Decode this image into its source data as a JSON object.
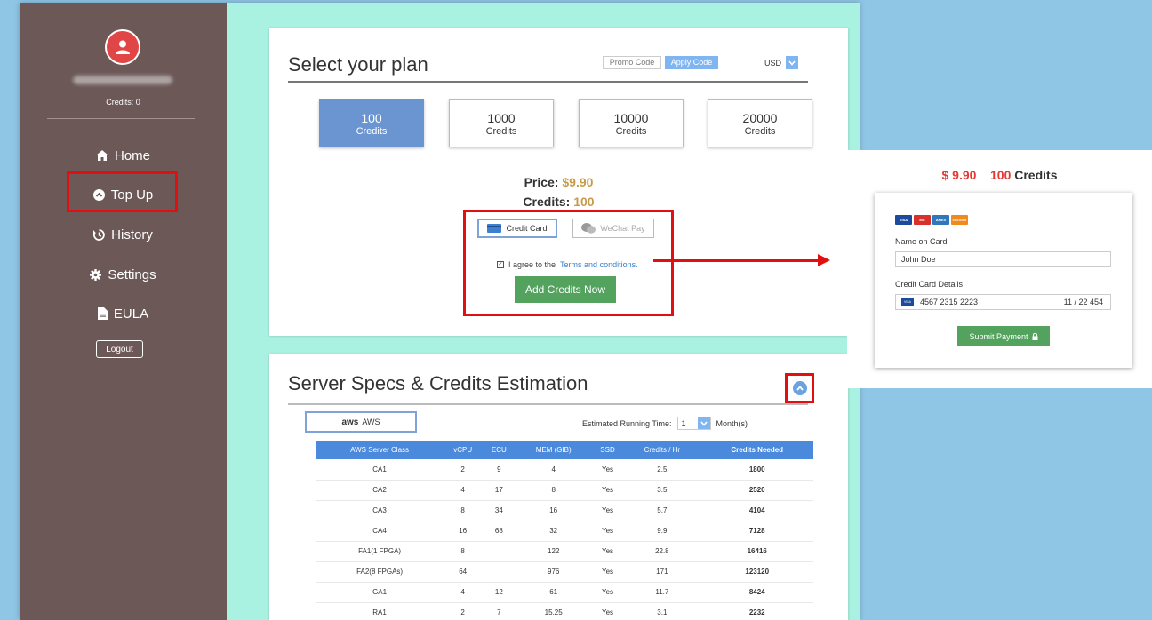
{
  "sidebar": {
    "credits": "Credits: 0",
    "nav": [
      {
        "label": "Home",
        "icon": "home-icon"
      },
      {
        "label": "Top Up",
        "icon": "chevron-up-circle-icon"
      },
      {
        "label": "History",
        "icon": "history-icon"
      },
      {
        "label": "Settings",
        "icon": "gear-icon"
      },
      {
        "label": "EULA",
        "icon": "file-icon"
      }
    ],
    "logout": "Logout"
  },
  "plan": {
    "title": "Select your plan",
    "promo_placeholder": "Promo Code",
    "apply_label": "Apply Code",
    "currency": "USD",
    "options": [
      {
        "amount": "100",
        "unit": "Credits"
      },
      {
        "amount": "1000",
        "unit": "Credits"
      },
      {
        "amount": "10000",
        "unit": "Credits"
      },
      {
        "amount": "20000",
        "unit": "Credits"
      }
    ],
    "price_label": "Price:",
    "price_value": "$9.90",
    "credits_label": "Credits:",
    "credits_value": "100",
    "credit_card_label": "Credit Card",
    "wechat_label": "WeChat Pay",
    "agree_text": "I agree to the",
    "terms_link": "Terms and conditions.",
    "add_button": "Add Credits Now"
  },
  "specs": {
    "title": "Server Specs & Credits Estimation",
    "provider": "AWS",
    "provider_logo": "aws",
    "running_time_label": "Estimated Running Time:",
    "running_time_value": "1",
    "running_time_unit": "Month(s)",
    "columns": [
      "AWS Server Class",
      "vCPU",
      "ECU",
      "MEM (GIB)",
      "SSD",
      "Credits / Hr",
      "Credits Needed"
    ],
    "rows": [
      [
        "CA1",
        "2",
        "9",
        "4",
        "Yes",
        "2.5",
        "1800"
      ],
      [
        "CA2",
        "4",
        "17",
        "8",
        "Yes",
        "3.5",
        "2520"
      ],
      [
        "CA3",
        "8",
        "34",
        "16",
        "Yes",
        "5.7",
        "4104"
      ],
      [
        "CA4",
        "16",
        "68",
        "32",
        "Yes",
        "9.9",
        "7128"
      ],
      [
        "FA1(1 FPGA)",
        "8",
        "",
        "122",
        "Yes",
        "22.8",
        "16416"
      ],
      [
        "FA2(8 FPGAs)",
        "64",
        "",
        "976",
        "Yes",
        "171",
        "123120"
      ],
      [
        "GA1",
        "4",
        "12",
        "61",
        "Yes",
        "11.7",
        "8424"
      ],
      [
        "RA1",
        "2",
        "7",
        "15.25",
        "Yes",
        "3.1",
        "2232"
      ]
    ]
  },
  "callout": {
    "price": "$ 9.90",
    "credits": "100 Credits",
    "card_brands": [
      "VISA",
      "MC",
      "AMEX",
      "DISCOVER"
    ],
    "name_label": "Name on Card",
    "name_value": "John Doe",
    "card_label": "Credit Card Details",
    "card_number": "4567 2315 2223",
    "card_expiry": "11 / 22  454",
    "submit": "Submit Payment"
  },
  "colors": {
    "sidebar": "#6b5857",
    "background": "#a9f1e0",
    "accent_blue": "#4a89dc",
    "green": "#53a35f",
    "highlight_red": "#e10f0f",
    "price_gold": "#c79a4b"
  }
}
